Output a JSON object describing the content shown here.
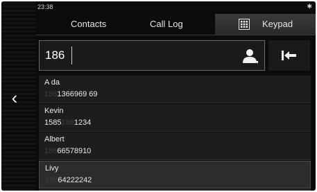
{
  "status": {
    "time": "23:38",
    "bluetooth_icon": "bluetooth-icon"
  },
  "tabs": [
    {
      "label": "Contacts",
      "active": false
    },
    {
      "label": "Call Log",
      "active": false
    },
    {
      "label": "Keypad",
      "active": true,
      "icon": "keypad-icon"
    }
  ],
  "search": {
    "value": "186",
    "contact_icon": "contact-icon"
  },
  "backspace": {
    "icon": "backspace-icon"
  },
  "back_icon": "chevron-left-icon",
  "contacts": [
    {
      "name": "A da",
      "number_dim": "186",
      "number_prefix": "",
      "number_rest": "1366969 69"
    },
    {
      "name": "Kevin",
      "number_prefix": "1585",
      "number_dim": "186",
      "number_rest": "1234"
    },
    {
      "name": "Albert",
      "number_dim": "186",
      "number_prefix": "",
      "number_rest": "66578910"
    },
    {
      "name": "Livy",
      "number_dim": "186",
      "number_prefix": "",
      "number_rest": "64222242"
    }
  ],
  "colors": {
    "background": "#0b0b0b",
    "row": "#1d1d1d",
    "row_selected": "#2c2c2c",
    "text": "#eaeaea",
    "dim_text": "#3c3c3c"
  }
}
